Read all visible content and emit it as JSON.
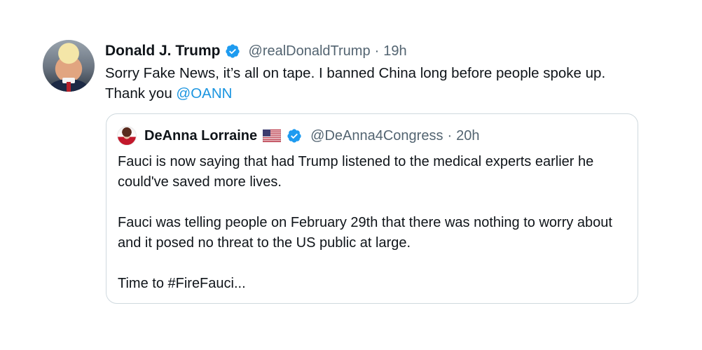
{
  "tweet": {
    "author_name": "Donald J. Trump",
    "handle": "@realDonaldTrump",
    "separator": "·",
    "time": "19h",
    "text_before_mention": "Sorry Fake News, it’s all on tape. I banned China long before people spoke up. Thank you ",
    "mention": "@OANN"
  },
  "quoted_tweet": {
    "author_name": "DeAnna Lorraine",
    "handle": "@DeAnna4Congress",
    "separator": "·",
    "time": "20h",
    "paragraphs": [
      "Fauci is now saying that had Trump listened to the medical experts earlier he could've saved more lives.",
      "Fauci was telling people on February 29th that there was nothing to worry about and it posed no threat to the US public at large.",
      "Time to #FireFauci..."
    ]
  },
  "colors": {
    "link_blue": "#1b95e0",
    "verified_blue": "#1d9bf0",
    "secondary_text": "#536471",
    "border": "#cfd9de"
  },
  "icons": {
    "verified": "verified-badge-icon",
    "flag": "us-flag-icon"
  }
}
